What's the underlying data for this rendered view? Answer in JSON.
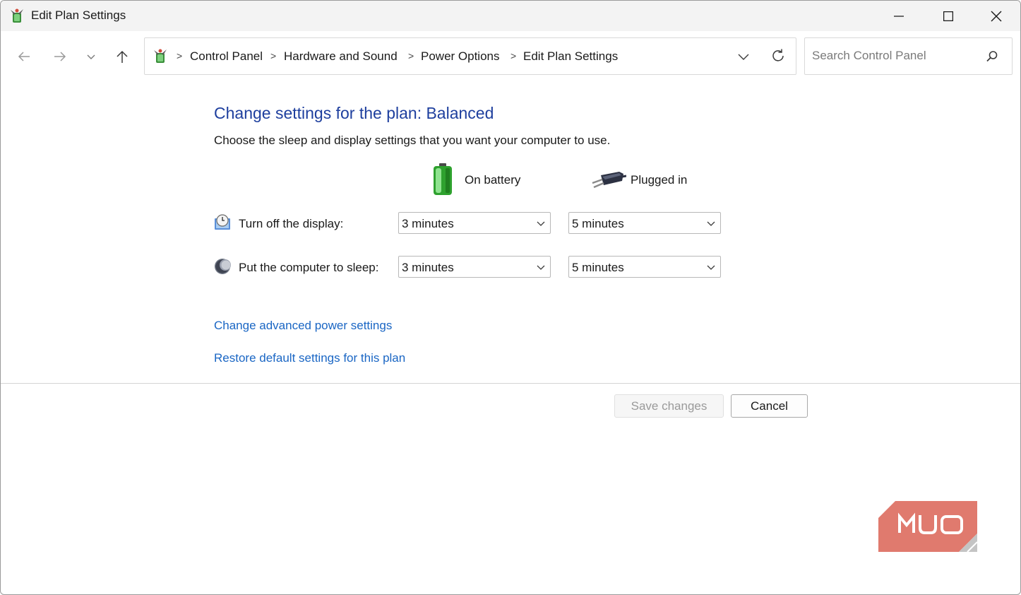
{
  "window": {
    "title": "Edit Plan Settings"
  },
  "address_bar": {
    "breadcrumbs": [
      "Control Panel",
      "Hardware and Sound",
      "Power Options",
      "Edit Plan Settings"
    ],
    "separator": ">"
  },
  "search": {
    "placeholder": "Search Control Panel"
  },
  "main": {
    "heading": "Change settings for the plan: Balanced",
    "subtext": "Choose the sleep and display settings that you want your computer to use.",
    "columns": {
      "battery": "On battery",
      "plugged": "Plugged in"
    },
    "settings": [
      {
        "label": "Turn off the display:",
        "on_battery": "3 minutes",
        "plugged_in": "5 minutes",
        "icon": "display-clock-icon"
      },
      {
        "label": "Put the computer to sleep:",
        "on_battery": "3 minutes",
        "plugged_in": "5 minutes",
        "icon": "sleep-moon-icon"
      }
    ],
    "links": {
      "advanced": "Change advanced power settings",
      "restore": "Restore default settings for this plan"
    }
  },
  "footer": {
    "save_label": "Save changes",
    "cancel_label": "Cancel"
  },
  "watermark": {
    "text": "MUO",
    "color": "#e07a6e"
  },
  "colors": {
    "heading": "#1e3f9e",
    "link": "#1a66c4",
    "titlebar": "#f3f3f3"
  }
}
